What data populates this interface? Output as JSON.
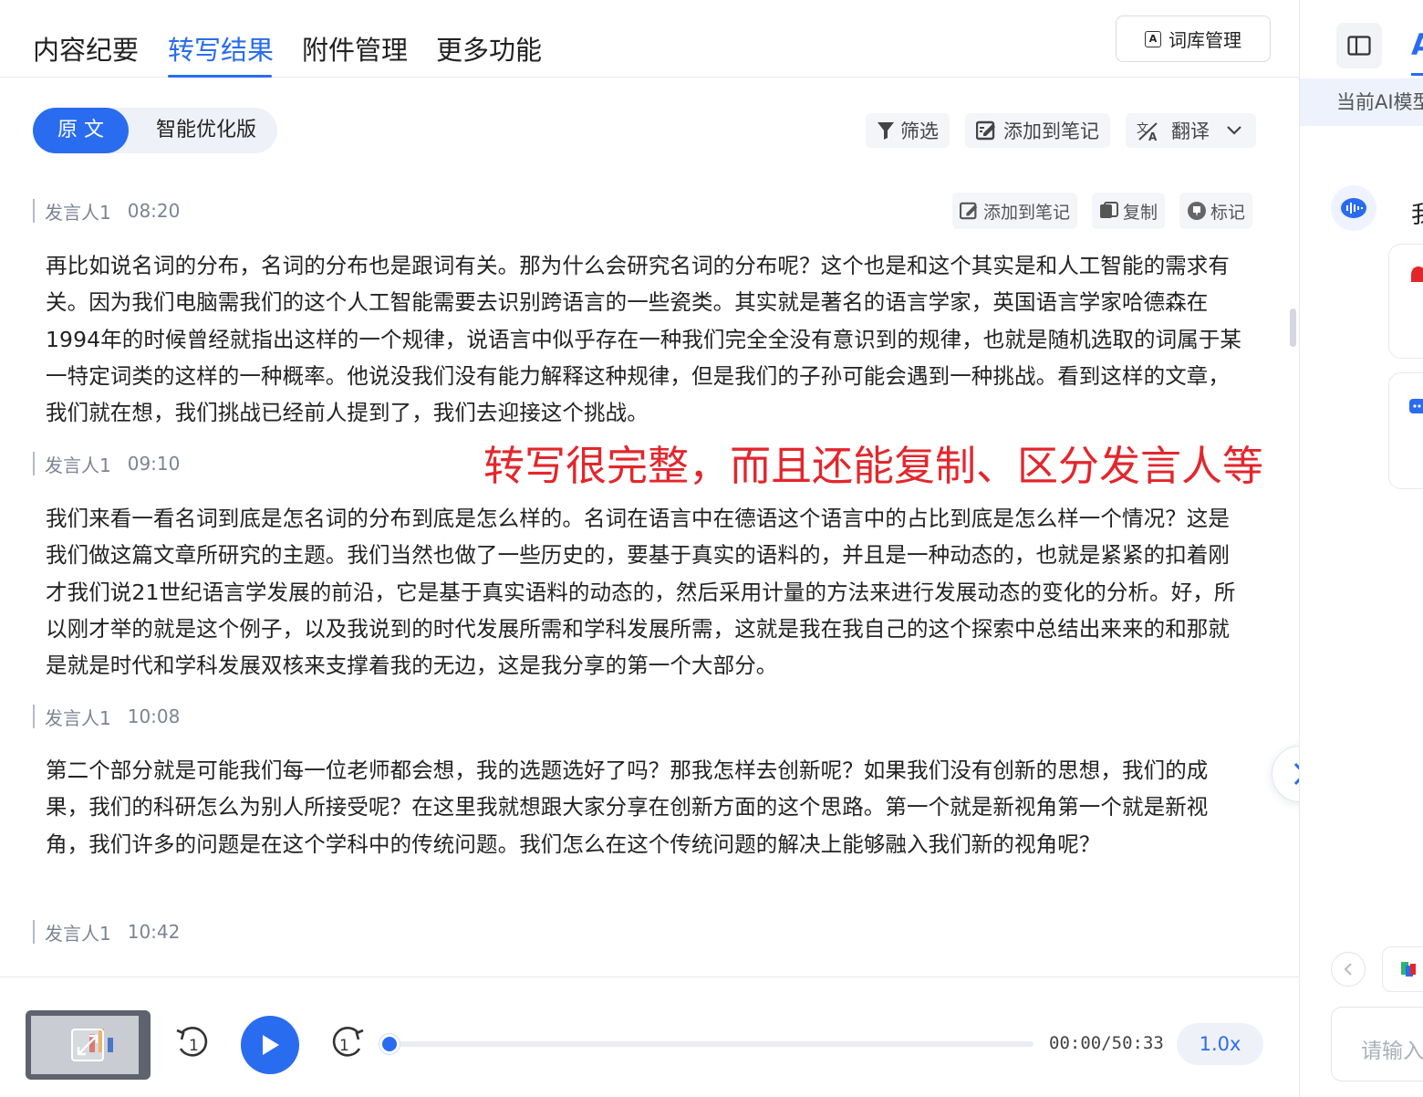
{
  "tabs": [
    {
      "label": "内容纪要",
      "active": false
    },
    {
      "label": "转写结果",
      "active": true
    },
    {
      "label": "附件管理",
      "active": false
    },
    {
      "label": "更多功能",
      "active": false
    }
  ],
  "lexicon_button": {
    "label": "词库管理",
    "icon": "a-letter-box-icon"
  },
  "version_toggle": {
    "options": [
      "原 文",
      "智能优化版"
    ],
    "selected": "原 文"
  },
  "toolbar": {
    "filter": "筛选",
    "add_note": "添加到笔记",
    "translate": "翻译"
  },
  "segment_actions": {
    "add_note": "添加到笔记",
    "copy": "复制",
    "mark": "标记"
  },
  "segments": [
    {
      "speaker": "发言人1",
      "time": "08:20",
      "text": "再比如说名词的分布，名词的分布也是跟词有关。那为什么会研究名词的分布呢？这个也是和这个其实是和人工智能的需求有关。因为我们电脑需我们的这个人工智能需要去识别跨语言的一些瓷类。其实就是著名的语言学家，英国语言学家哈德森在1994年的时候曾经就指出这样的一个规律，说语言中似乎存在一种我们完全全没有意识到的规律，也就是随机选取的词属于某一特定词类的这样的一种概率。他说没我们没有能力解释这种规律，但是我们的子孙可能会遇到一种挑战。看到这样的文章，我们就在想，我们挑战已经前人提到了，我们去迎接这个挑战。"
    },
    {
      "speaker": "发言人1",
      "time": "09:10",
      "text": "我们来看一看名词到底是怎名词的分布到底是怎么样的。名词在语言中在德语这个语言中的占比到底是怎么样一个情况？这是我们做这篇文章所研究的主题。我们当然也做了一些历史的，要基于真实的语料的，并且是一种动态的，也就是紧紧的扣着刚才我们说21世纪语言学发展的前沿，它是基于真实语料的动态的，然后采用计量的方法来进行发展动态的变化的分析。好，所以刚才举的就是这个例子，以及我说到的时代发展所需和学科发展所需，这就是我在我自己的这个探索中总结出来来的和那就是就是时代和学科发展双核来支撑着我的无边，这是我分享的第一个大部分。"
    },
    {
      "speaker": "发言人1",
      "time": "10:08",
      "text": "第二个部分就是可能我们每一位老师都会想，我的选题选好了吗？那我怎样去创新呢？如果我们没有创新的思想，我们的成果，我们的科研怎么为别人所接受呢？在这里我就想跟大家分享在创新方面的这个思路。第一个就是新视角第一个就是新视角，我们许多的问题是在这个学科中的传统问题。我们怎么在这个传统问题的解决上能够融入我们新的视角呢？"
    },
    {
      "speaker": "发言人1",
      "time": "10:42",
      "text": ""
    }
  ],
  "annotation": "转写很完整，而且还能复制、区分发言人等",
  "player": {
    "current": "00:00",
    "total": "50:33",
    "separator": "/",
    "speed": "1.0x",
    "progress": 0.0,
    "rewind_step": "1",
    "forward_step": "1"
  },
  "right_panel": {
    "tab_label": "A",
    "banner": "当前AI模型",
    "greeting": "我",
    "input_placeholder": "请输入"
  },
  "colors": {
    "accent": "#2a6cf0",
    "annotation": "#e3262c"
  }
}
